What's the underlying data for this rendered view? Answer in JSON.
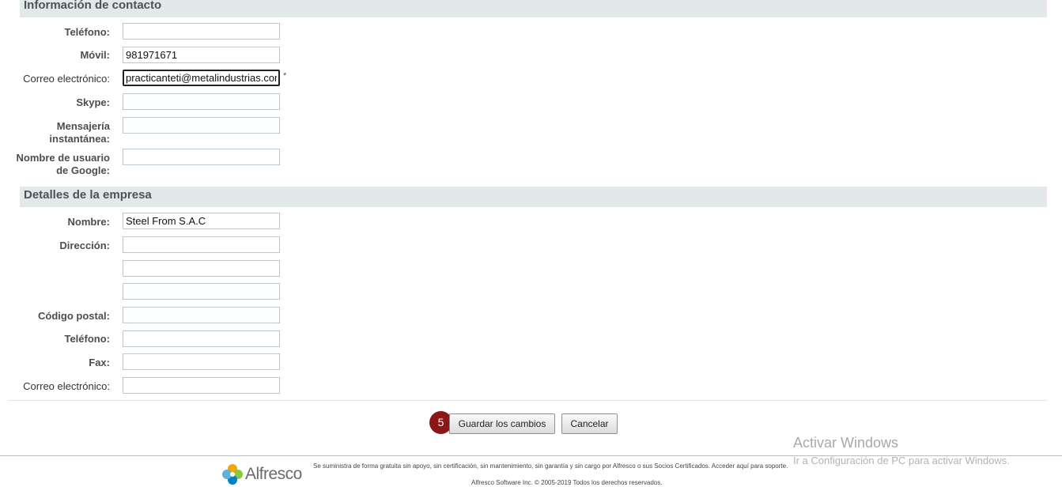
{
  "contact": {
    "header": "Información de contacto",
    "phone_label": "Teléfono:",
    "phone_value": "",
    "mobile_label": "Móvil:",
    "mobile_value": "981971671",
    "email_label": "Correo electrónico:",
    "email_value": "practicanteti@metalindustrias.com",
    "required_mark": "*",
    "skype_label": "Skype:",
    "skype_value": "",
    "im_label_line1": "Mensajería",
    "im_label_line2": "instantánea:",
    "im_value": "",
    "google_label_line1": "Nombre de usuario",
    "google_label_line2": "de Google:",
    "google_value": ""
  },
  "company": {
    "header": "Detalles de la empresa",
    "name_label": "Nombre:",
    "name_value": "Steel From S.A.C",
    "address_label": "Dirección:",
    "address_line1": "",
    "address_line2": "",
    "address_line3": "",
    "postal_label": "Código postal:",
    "postal_value": "",
    "phone_label": "Teléfono:",
    "phone_value": "",
    "fax_label": "Fax:",
    "fax_value": "",
    "email_label": "Correo electrónico:",
    "email_value": ""
  },
  "actions": {
    "step_number": "5",
    "save_label": "Guardar los cambios",
    "cancel_label": "Cancelar"
  },
  "footer": {
    "logo_text": "Alfresco",
    "support_text": "Se suministra de forma gratuita sin apoyo, sin certificación, sin mantenimiento, sin garantía y sin cargo por Alfresco o sus Socios Certificados. Acceder aquí para soporte.",
    "copyright": "Alfresco Software Inc. © 2005-2019 Todos los derechos reservados."
  },
  "watermark": {
    "title": "Activar Windows",
    "subtitle": "Ir a Configuración de PC para activar Windows."
  },
  "colors": {
    "section_header_bg": "#e3e8ea",
    "step_badge": "#8b1616"
  }
}
